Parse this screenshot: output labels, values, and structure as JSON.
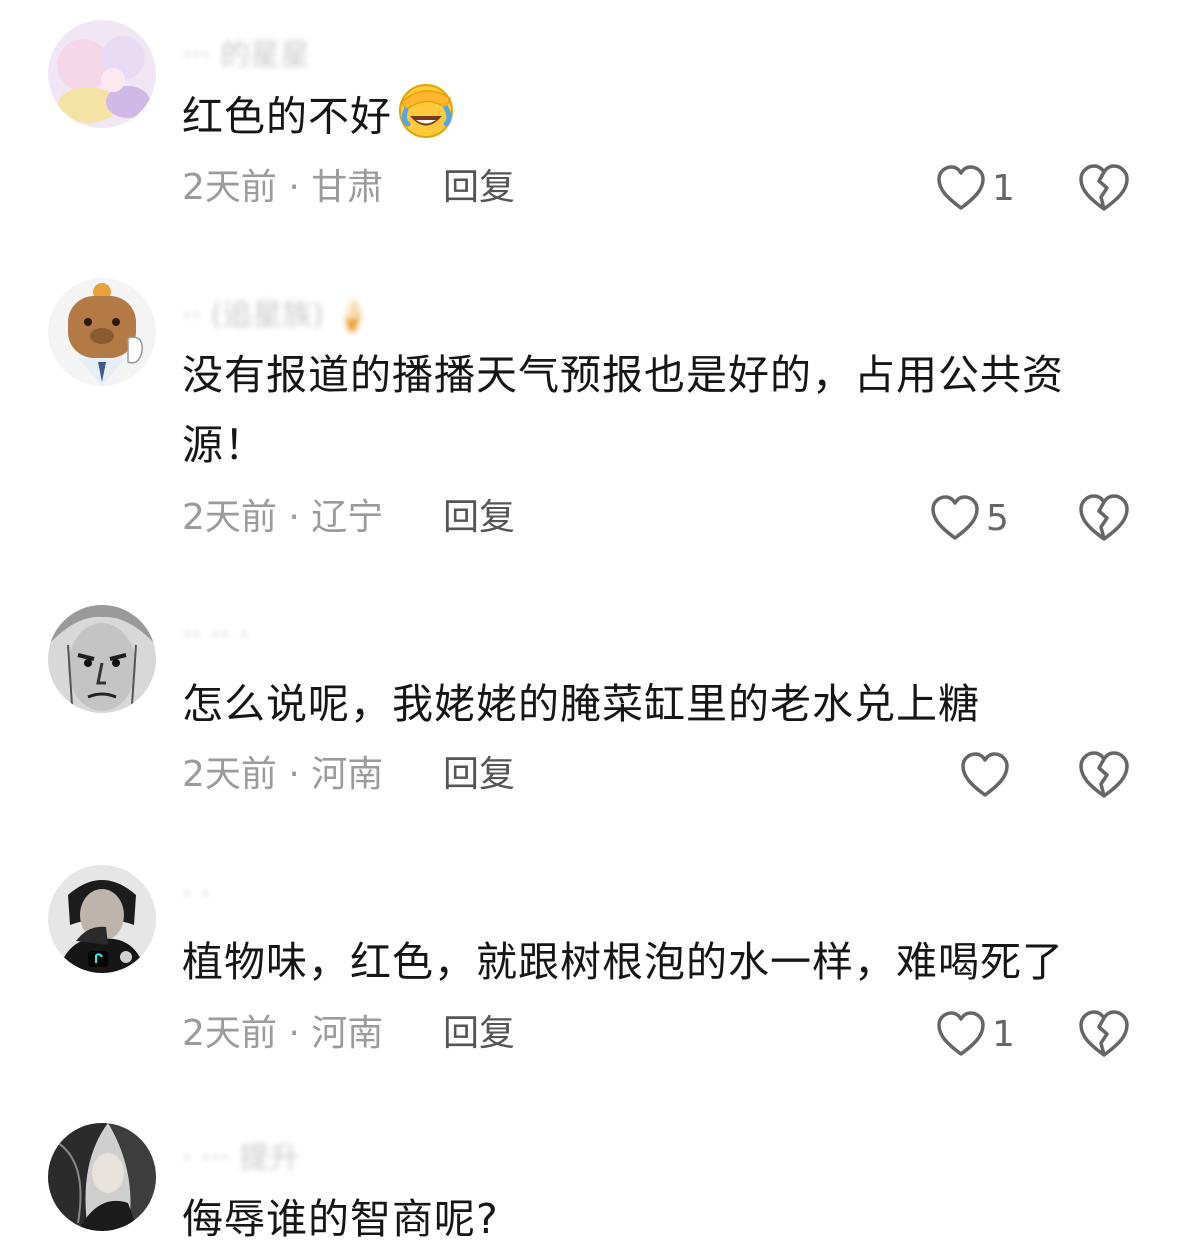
{
  "comments": [
    {
      "username": "··· 的星星",
      "text": "红色的不好",
      "emoji": "🤦",
      "time": "2天前",
      "location": "甘肃",
      "reply_label": "回复",
      "likes": "1"
    },
    {
      "username": "·· (追星族) 🍦",
      "text": "没有报道的播播天气预报也是好的，占用公共资源！",
      "time": "2天前",
      "location": "辽宁",
      "reply_label": "回复",
      "likes": "5"
    },
    {
      "username": "·· ·· ·",
      "text": "怎么说呢，我姥姥的腌菜缸里的老水兑上糖",
      "time": "2天前",
      "location": "河南",
      "reply_label": "回复",
      "likes": ""
    },
    {
      "username": "· ·",
      "text": "植物味，红色，就跟树根泡的水一样，难喝死了",
      "time": "2天前",
      "location": "河南",
      "reply_label": "回复",
      "likes": "1"
    },
    {
      "username": "· ··· 提升",
      "text": "侮辱谁的智商呢?",
      "time": "",
      "location": "",
      "reply_label": "",
      "likes": ""
    }
  ],
  "colors": {
    "text": "#161616",
    "meta": "#9b9b9b",
    "icon": "#666666"
  }
}
